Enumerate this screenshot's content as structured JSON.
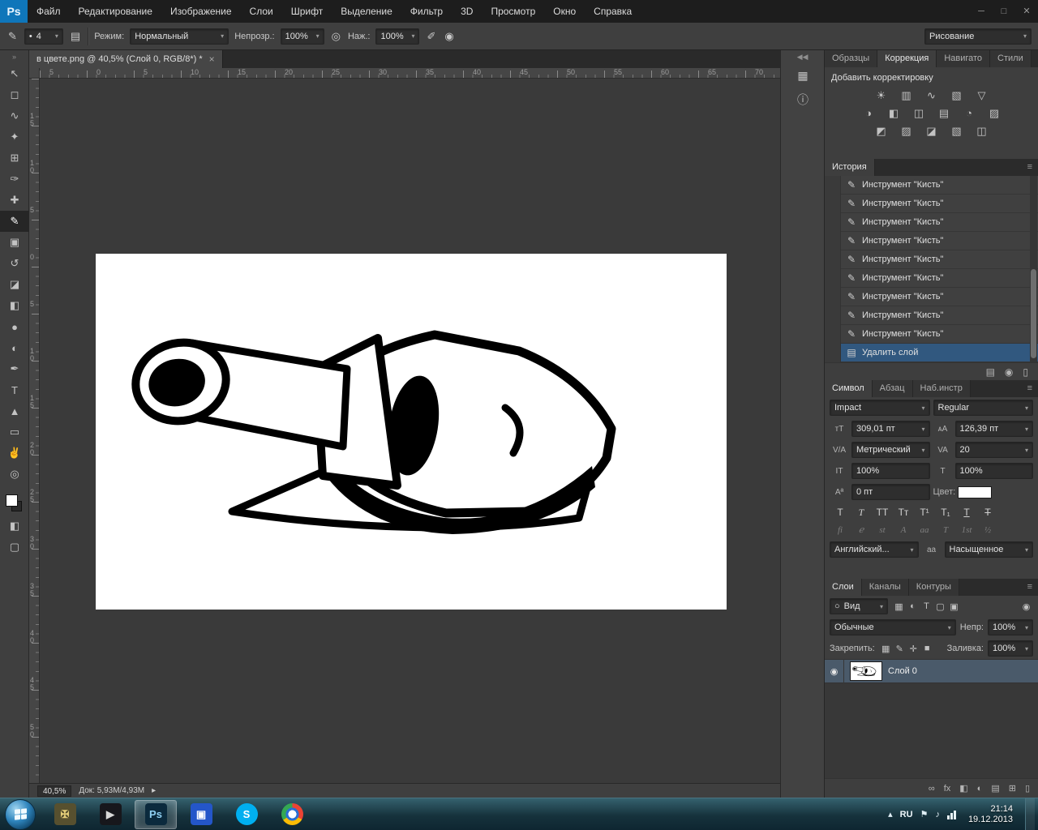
{
  "colors": {
    "accent_blue": "#0f76ba",
    "history_selection": "#31587f",
    "layer_selection": "#4a5a6a",
    "taskbar_teal": "#16323c"
  },
  "menu_bar": {
    "logo": "Ps",
    "items": [
      "Файл",
      "Редактирование",
      "Изображение",
      "Слои",
      "Шрифт",
      "Выделение",
      "Фильтр",
      "3D",
      "Просмотр",
      "Окно",
      "Справка"
    ],
    "window_buttons": [
      {
        "name": "minimize-button",
        "glyph": "─"
      },
      {
        "name": "restore-button",
        "glyph": "□"
      },
      {
        "name": "close-button",
        "glyph": "✕"
      }
    ]
  },
  "options_bar": {
    "tool_icon": "✎",
    "preset_arrow": "▾",
    "brush_dot": "•",
    "brush_size": "4",
    "panel_toggle_icon": "▤",
    "mode_label": "Режим:",
    "mode_value": "Нормальный",
    "opacity_label": "Непрозр.:",
    "opacity_value": "100%",
    "airbrush_icon": "◎",
    "flow_label": "Наж.:",
    "flow_value": "100%",
    "airbrush2_icon": "✐",
    "pressure_icon": "◉",
    "workspace_value": "Рисование"
  },
  "tools": {
    "collapse": "»",
    "items": [
      {
        "name": "move-tool",
        "glyph": "↖"
      },
      {
        "name": "marquee-tool",
        "glyph": "◻"
      },
      {
        "name": "lasso-tool",
        "glyph": "∿"
      },
      {
        "name": "quick-selection-tool",
        "glyph": "✦"
      },
      {
        "name": "crop-tool",
        "glyph": "⊞"
      },
      {
        "name": "eyedropper-tool",
        "glyph": "✑"
      },
      {
        "name": "healing-brush-tool",
        "glyph": "✚"
      },
      {
        "name": "brush-tool",
        "glyph": "✎",
        "selected": true
      },
      {
        "name": "clone-stamp-tool",
        "glyph": "▣"
      },
      {
        "name": "history-brush-tool",
        "glyph": "↺"
      },
      {
        "name": "eraser-tool",
        "glyph": "◪"
      },
      {
        "name": "gradient-tool",
        "glyph": "◧"
      },
      {
        "name": "blur-tool",
        "glyph": "●"
      },
      {
        "name": "dodge-tool",
        "glyph": "◐"
      },
      {
        "name": "pen-tool",
        "glyph": "✒"
      },
      {
        "name": "type-tool",
        "glyph": "T"
      },
      {
        "name": "path-selection-tool",
        "glyph": "▲"
      },
      {
        "name": "shape-tool",
        "glyph": "▭"
      },
      {
        "name": "hand-tool",
        "glyph": "✌"
      },
      {
        "name": "zoom-tool",
        "glyph": "◎"
      }
    ]
  },
  "document": {
    "tab_title": "в цвете.png @ 40,5% (Слой 0, RGB/8*) *",
    "close": "×",
    "ruler_h": [
      "5",
      "0",
      "5",
      "10",
      "15",
      "20",
      "25",
      "30",
      "35",
      "40",
      "45",
      "50",
      "55",
      "60",
      "65",
      "70"
    ],
    "ruler_v": [
      "1\n5",
      "1\n0",
      "5",
      "0",
      "5",
      "1\n0",
      "1\n5",
      "2\n0",
      "2\n5",
      "3\n0",
      "3\n5",
      "4\n0",
      "4\n5",
      "5\n0"
    ],
    "status_zoom": "40,5%",
    "status_doc": "Док: 5,93М/4,93М",
    "status_arrow": "▸"
  },
  "icon_dock": {
    "collapse": "◀◀",
    "icons": [
      {
        "name": "materials-panel-icon",
        "glyph": "▦"
      },
      {
        "name": "info-panel-icon",
        "glyph": "ⓘ"
      }
    ]
  },
  "panel_chrome": {
    "menu_icon": "≡"
  },
  "adjustments": {
    "tabs": [
      {
        "label": "Образцы"
      },
      {
        "label": "Коррекция",
        "active": true
      },
      {
        "label": "Навигато"
      },
      {
        "label": "Стили"
      }
    ],
    "title": "Добавить корректировку",
    "row1": [
      "☀",
      "▥",
      "∿",
      "▧",
      "▽"
    ],
    "row2": [
      "◑",
      "◧",
      "◫",
      "▤",
      "◔",
      "▨"
    ],
    "row3": [
      "◩",
      "▨",
      "◪",
      "▧",
      "◫"
    ]
  },
  "history": {
    "title": "История",
    "items": [
      {
        "icon": "✎",
        "label": "Инструмент \"Кисть\""
      },
      {
        "icon": "✎",
        "label": "Инструмент \"Кисть\""
      },
      {
        "icon": "✎",
        "label": "Инструмент \"Кисть\""
      },
      {
        "icon": "✎",
        "label": "Инструмент \"Кисть\""
      },
      {
        "icon": "✎",
        "label": "Инструмент \"Кисть\""
      },
      {
        "icon": "✎",
        "label": "Инструмент \"Кисть\""
      },
      {
        "icon": "✎",
        "label": "Инструмент \"Кисть\""
      },
      {
        "icon": "✎",
        "label": "Инструмент \"Кисть\""
      },
      {
        "icon": "✎",
        "label": "Инструмент \"Кисть\""
      },
      {
        "icon": "▤",
        "label": "Удалить слой",
        "selected": true
      }
    ],
    "footer_icons": [
      {
        "name": "new-document-from-state-icon",
        "glyph": "▤"
      },
      {
        "name": "new-snapshot-icon",
        "glyph": "◉"
      },
      {
        "name": "delete-state-icon",
        "glyph": "▯"
      }
    ]
  },
  "character": {
    "tabs": [
      {
        "label": "Символ",
        "active": true
      },
      {
        "label": "Абзац"
      },
      {
        "label": "Наб.инстр"
      }
    ],
    "font_family": "Impact",
    "font_style": "Regular",
    "size_icon": "тT",
    "size": "309,01 пт",
    "leading_icon": "ᴀA",
    "leading": "126,39 пт",
    "kerning_icon": "V/A",
    "kerning": "Метрический",
    "tracking_icon": "VA",
    "tracking": "20",
    "vscale_icon": "IT",
    "vscale": "100%",
    "hscale_icon": "T",
    "hscale": "100%",
    "baseline_icon": "Aª",
    "baseline": "0 пт",
    "color_label": "Цвет:",
    "style_buttons": [
      {
        "glyph": "T",
        "cls": "b"
      },
      {
        "glyph": "T",
        "cls": "i"
      },
      {
        "glyph": "TT"
      },
      {
        "glyph": "Tᴛ"
      },
      {
        "glyph": "T¹"
      },
      {
        "glyph": "T₁"
      },
      {
        "glyph": "T",
        "cls": "u"
      },
      {
        "glyph": "T",
        "cls": "s"
      }
    ],
    "opentype_buttons": [
      {
        "glyph": "fi"
      },
      {
        "glyph": "ℯ"
      },
      {
        "glyph": "st"
      },
      {
        "glyph": "A"
      },
      {
        "glyph": "aa"
      },
      {
        "glyph": "T"
      },
      {
        "glyph": "1st"
      },
      {
        "glyph": "½"
      }
    ],
    "language": "Английский...",
    "aa_icon": "aa",
    "antialias": "Насыщенное"
  },
  "layers": {
    "tabs": [
      {
        "label": "Слои",
        "active": true
      },
      {
        "label": "Каналы"
      },
      {
        "label": "Контуры"
      }
    ],
    "filter_label": "Вид",
    "filter_search_icon": "○",
    "filter_icons": [
      {
        "name": "filter-pixel-layers-icon",
        "glyph": "▦"
      },
      {
        "name": "filter-adjustment-layers-icon",
        "glyph": "◐"
      },
      {
        "name": "filter-type-layers-icon",
        "glyph": "T"
      },
      {
        "name": "filter-shape-layers-icon",
        "glyph": "▢"
      },
      {
        "name": "filter-smart-objects-icon",
        "glyph": "▣"
      }
    ],
    "filter_toggle_icon": "◉",
    "blend_mode": "Обычные",
    "opacity_label": "Непр:",
    "opacity": "100%",
    "lock_label": "Закрепить:",
    "lock_icons": [
      {
        "name": "lock-transparency-icon",
        "glyph": "▦"
      },
      {
        "name": "lock-pixels-icon",
        "glyph": "✎"
      },
      {
        "name": "lock-position-icon",
        "glyph": "✛"
      },
      {
        "name": "lock-all-icon",
        "glyph": "■"
      }
    ],
    "fill_label": "Заливка:",
    "fill": "100%",
    "eye_icon": "◉",
    "layer_name": "Слой 0",
    "footer_icons": [
      {
        "name": "link-layers-icon",
        "glyph": "∞"
      },
      {
        "name": "layer-effects-icon",
        "glyph": "fx"
      },
      {
        "name": "layer-mask-icon",
        "glyph": "◧"
      },
      {
        "name": "adjustment-layer-icon",
        "glyph": "◐"
      },
      {
        "name": "layer-group-icon",
        "glyph": "▤"
      },
      {
        "name": "new-layer-icon",
        "glyph": "⊞"
      },
      {
        "name": "delete-layer-icon",
        "glyph": "▯"
      }
    ]
  },
  "taskbar": {
    "apps": [
      {
        "name": "taskbar-app-game",
        "glyph": "✠",
        "bg": "#57502f",
        "fg": "#e6cf7a"
      },
      {
        "name": "taskbar-app-media-player",
        "glyph": "▶",
        "bg": "#17171c",
        "fg": "#d8d8d8"
      },
      {
        "name": "taskbar-app-photoshop",
        "glyph": "Ps",
        "bg": "#0b2a3d",
        "fg": "#8fd0f2",
        "active": true
      },
      {
        "name": "taskbar-app-save",
        "glyph": "▣",
        "bg": "#2456c9",
        "fg": "#ffffff"
      },
      {
        "name": "taskbar-app-skype",
        "glyph": "S",
        "bg": "#00aff0",
        "fg": "#ffffff",
        "cls": "round"
      },
      {
        "name": "taskbar-app-chrome",
        "glyph": "",
        "cls": "chrome round"
      }
    ],
    "tray": {
      "hidden_icons": "▴",
      "lang": "RU",
      "flag_icon": "⚑",
      "volume_icon": "♪",
      "time": "21:14",
      "date": "19.12.2013"
    }
  }
}
